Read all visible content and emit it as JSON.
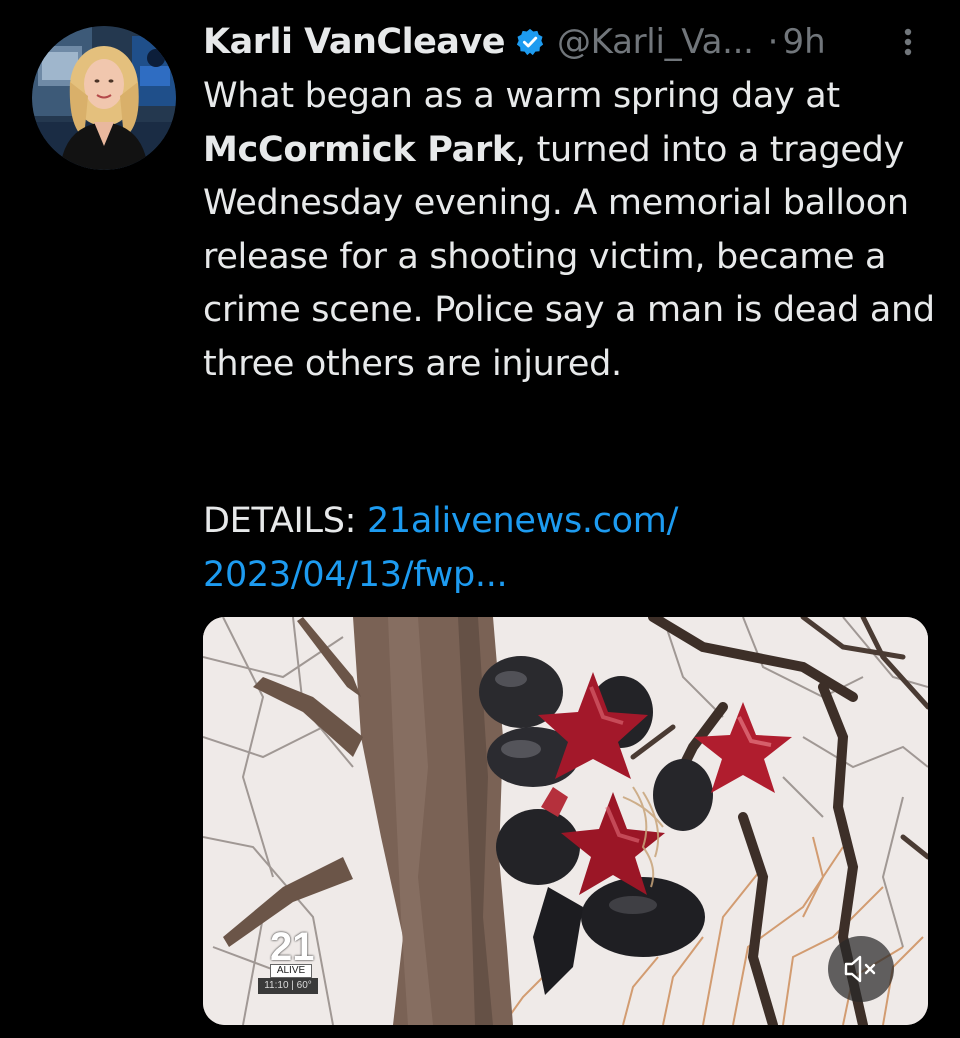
{
  "tweet": {
    "author_name": "Karli VanCleave",
    "handle": "@Karli_Va...",
    "separator": "·",
    "time": "9h",
    "body": {
      "text_before": "What began as a warm spring day at ",
      "bold_text": "McCormick Park",
      "text_after": ", turned into a tragedy Wednesday evening. A memorial balloon release for a shooting victim, became a crime scene. Police say a man is dead and three others are injured."
    },
    "details_label": "DETAILS: ",
    "details_link": "21alivenews.com/ 2023/04/13/fwp..."
  },
  "media": {
    "station_logo_number": "21",
    "station_logo_word": "ALIVE",
    "station_bug": "11:10 | 60°",
    "mute_icon": "speaker-muted-icon"
  },
  "icons": {
    "verified": "verified-badge-icon",
    "more": "more-vertical-icon"
  },
  "colors": {
    "background": "#000000",
    "primary_text": "#e7e9ea",
    "secondary_text": "#71767b",
    "link": "#1d9bf0",
    "verified": "#1d9bf0"
  }
}
